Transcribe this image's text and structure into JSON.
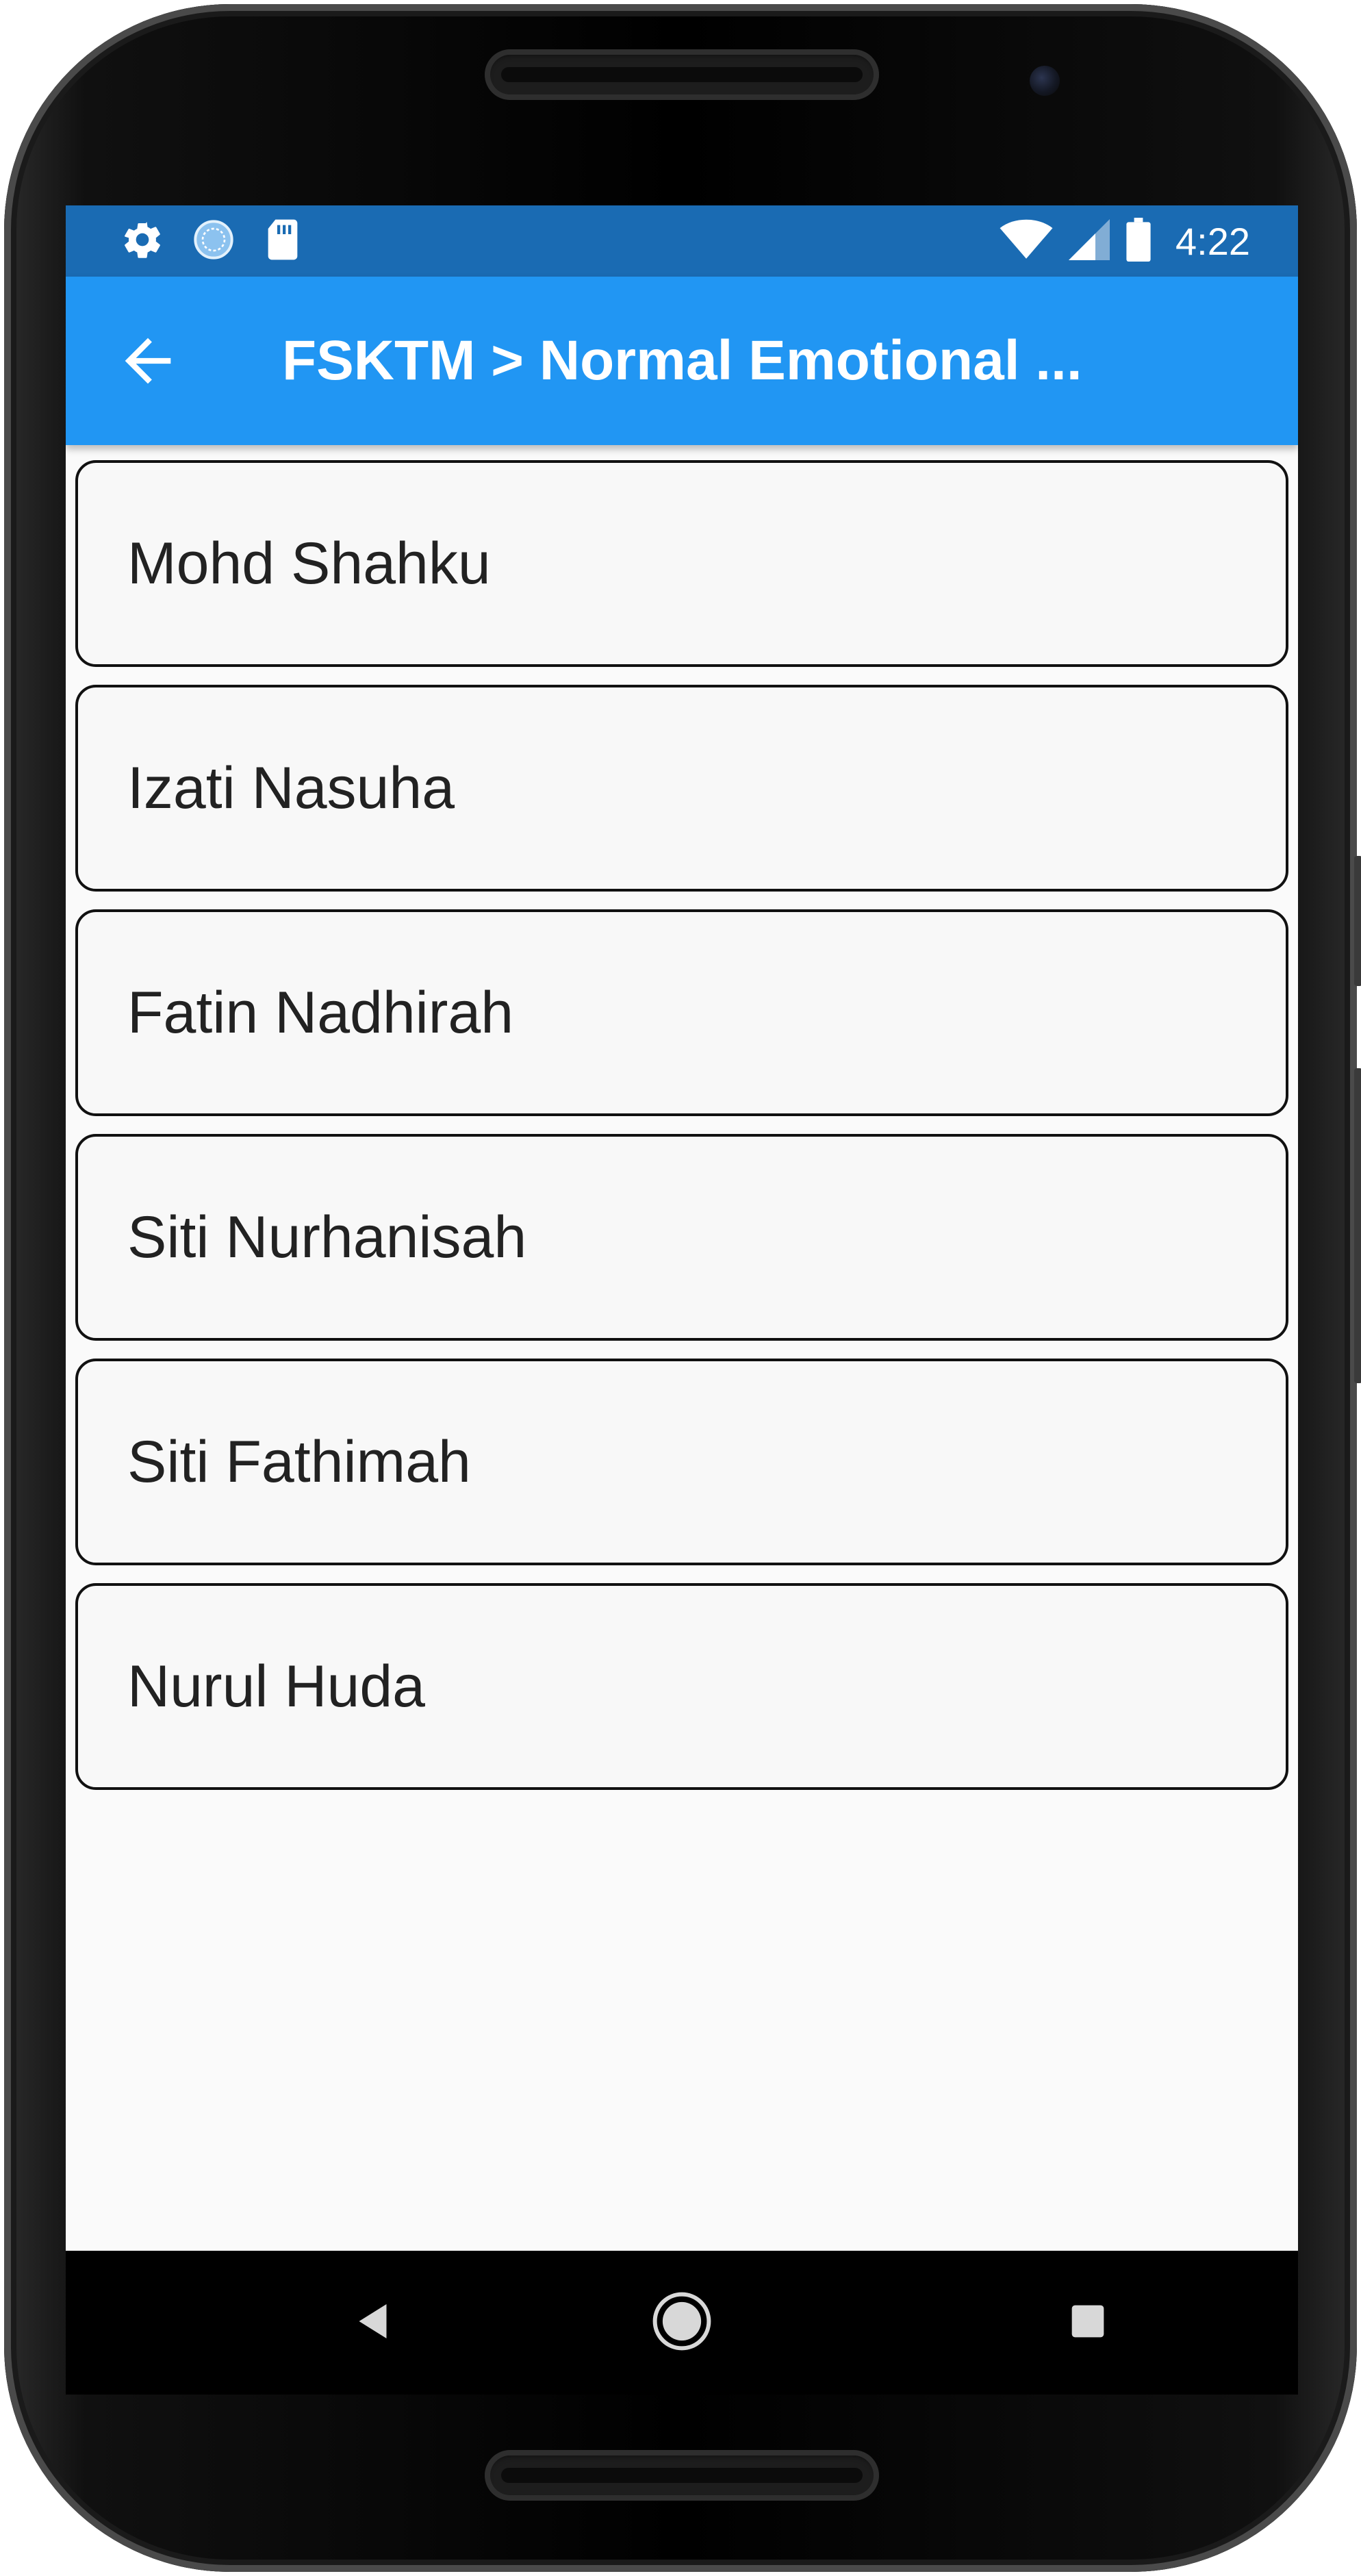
{
  "status_bar": {
    "left_icons": [
      "gear-icon",
      "sync-circle-icon",
      "sd-card-icon"
    ],
    "right_icons": [
      "wifi-icon",
      "cell-signal-icon",
      "battery-icon"
    ],
    "time": "4:22"
  },
  "app_bar": {
    "back_icon": "arrow-left-icon",
    "title": "FSKTM > Normal Emotional ..."
  },
  "list": {
    "items": [
      {
        "label": "Mohd Shahku"
      },
      {
        "label": "Izati Nasuha"
      },
      {
        "label": "Fatin Nadhirah"
      },
      {
        "label": "Siti Nurhanisah"
      },
      {
        "label": "Siti Fathimah"
      },
      {
        "label": "Nurul Huda"
      }
    ]
  },
  "nav_bar": {
    "icons": [
      "back-triangle-icon",
      "home-circle-icon",
      "recents-square-icon"
    ]
  },
  "colors": {
    "status_bar": "#1a6bb3",
    "app_bar": "#2196f3",
    "background": "#fafafa",
    "card_background": "#f8f8f8",
    "card_border": "#111111"
  }
}
